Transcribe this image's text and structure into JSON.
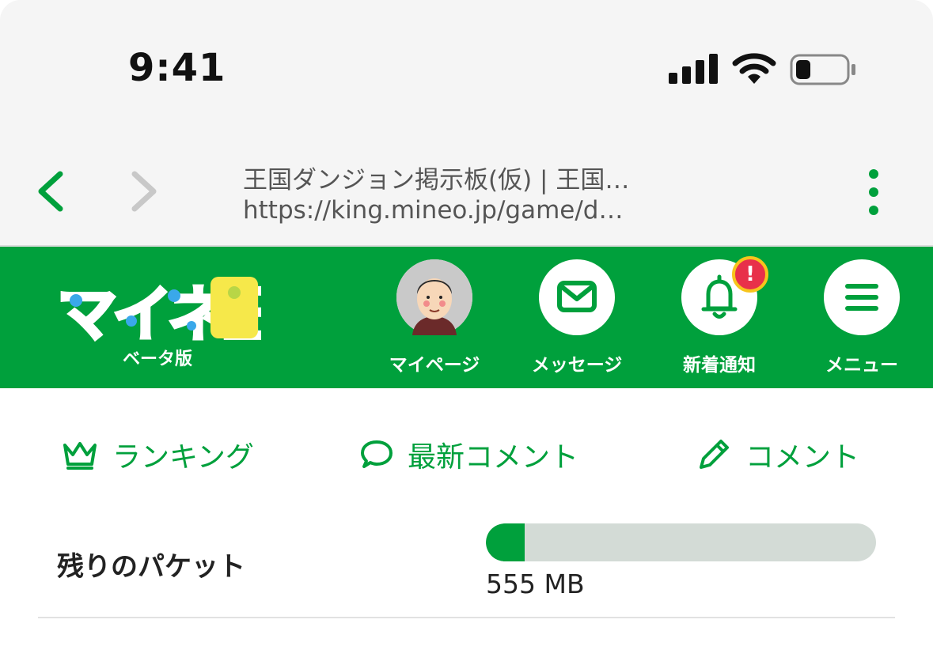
{
  "status_bar": {
    "time": "9:41"
  },
  "browser": {
    "page_title": "王国ダンジョン掲示板(仮) | 王国…",
    "url": "https://king.mineo.jp/game/d…"
  },
  "header": {
    "logo_text": "マイネ王",
    "beta_label": "ベータ版",
    "buttons": [
      {
        "label": "マイページ",
        "icon": "avatar"
      },
      {
        "label": "メッセージ",
        "icon": "mail-icon"
      },
      {
        "label": "新着通知",
        "icon": "bell-icon",
        "badge": "!"
      },
      {
        "label": "メニュー",
        "icon": "menu-icon"
      }
    ]
  },
  "tabs": [
    {
      "label": "ランキング",
      "icon": "crown-icon"
    },
    {
      "label": "最新コメント",
      "icon": "speech-bubble-icon"
    },
    {
      "label": "コメント",
      "icon": "pencil-icon"
    }
  ],
  "packet": {
    "label": "残りのパケット",
    "value": "555 MB",
    "fill_fraction": 0.1
  },
  "colors": {
    "brand_green": "#00a03c",
    "badge_red": "#e8304a",
    "badge_ring": "#f7c51c",
    "track": "#d3dbd6"
  }
}
